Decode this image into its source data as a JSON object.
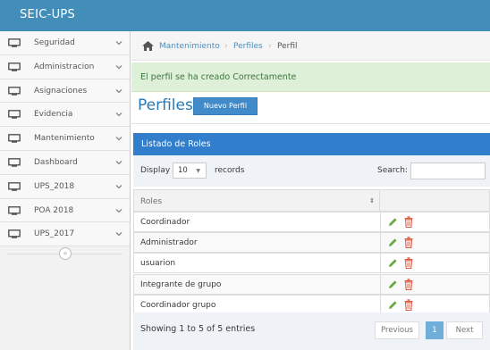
{
  "app": {
    "brand": "SEIC-UPS"
  },
  "sidebar": {
    "items": [
      {
        "label": "Seguridad"
      },
      {
        "label": "Administracion"
      },
      {
        "label": "Asignaciones"
      },
      {
        "label": "Evidencia"
      },
      {
        "label": "Mantenimiento"
      },
      {
        "label": "Dashboard"
      },
      {
        "label": "UPS_2018"
      },
      {
        "label": "POA 2018"
      },
      {
        "label": "UPS_2017"
      }
    ],
    "collapse_glyph": "«"
  },
  "breadcrumb": {
    "items": [
      "Mantenimiento",
      "Perfiles",
      "Perfil"
    ],
    "separator": "›"
  },
  "alert": {
    "text": "El perfil se ha creado Correctamente"
  },
  "page": {
    "title": "Perfiles",
    "new_button": "Nuevo Perfil"
  },
  "widget": {
    "title": "Listado de Roles"
  },
  "table_controls": {
    "display_label": "Display",
    "display_value": "10",
    "records_label": "records",
    "search_label": "Search:"
  },
  "table": {
    "columns": [
      "Roles",
      ""
    ],
    "rows": [
      {
        "name": "Coordinador"
      },
      {
        "name": "Administrador"
      },
      {
        "name": "usuarion"
      },
      {
        "name": "Integrante de grupo"
      },
      {
        "name": "Coordinador grupo"
      }
    ]
  },
  "footer": {
    "info": "Showing 1 to 5 of 5 entries",
    "previous": "Previous",
    "current_page": "1",
    "next": "Next"
  },
  "colors": {
    "topbar": "#438eb9",
    "widget_header": "#307ecc",
    "alert_bg": "#dff0d8",
    "edit_icon": "#69aa46",
    "delete_icon": "#dd5a43"
  }
}
